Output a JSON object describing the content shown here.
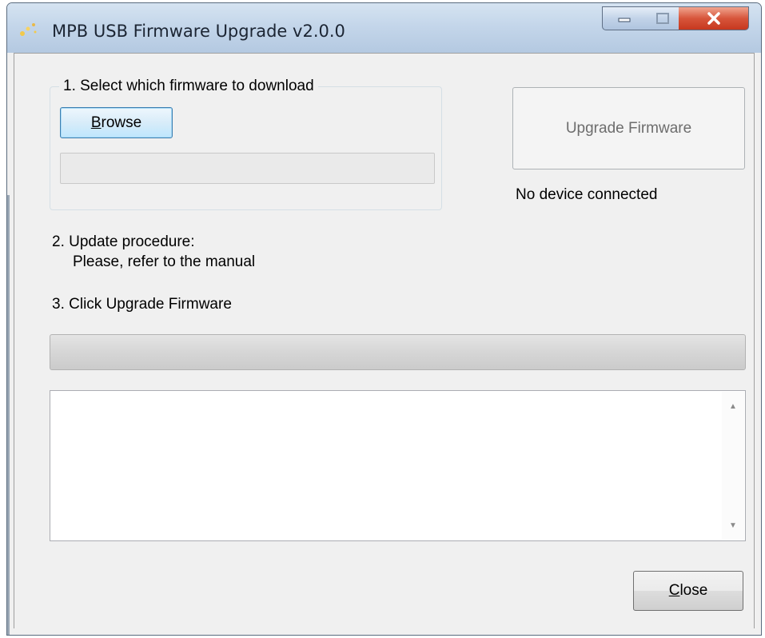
{
  "window": {
    "title": "MPB USB Firmware Upgrade v2.0.0",
    "icon": "app-sparkle-icon",
    "controls": {
      "minimize": "minimize-icon",
      "maximize": "maximize-icon",
      "close": "close-icon"
    }
  },
  "step1": {
    "group_title": "1. Select which firmware to download",
    "browse_mnemonic": "B",
    "browse_rest": "rowse",
    "file_path": ""
  },
  "upgrade": {
    "button_label": "Upgrade Firmware",
    "status": "No device connected"
  },
  "step2": {
    "line1": "2. Update procedure:",
    "line2": "Please, refer to the manual"
  },
  "step3": {
    "label": "3. Click Upgrade Firmware"
  },
  "progress": {
    "value": 0
  },
  "log": {
    "text": ""
  },
  "footer": {
    "close_mnemonic": "C",
    "close_rest": "lose"
  },
  "colors": {
    "title_bar": "#c4d6ea",
    "close_button": "#d7553b",
    "window_bg": "#f0f0f0"
  }
}
